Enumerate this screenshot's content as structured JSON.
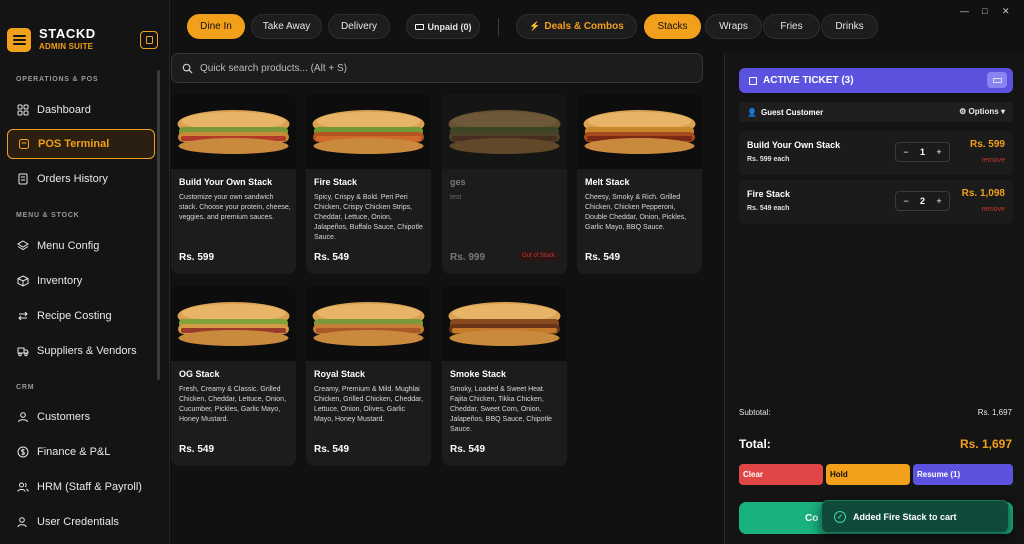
{
  "brand": {
    "name": "STACKD",
    "subtitle": "ADMIN SUITE"
  },
  "sidebar": {
    "sections": [
      "OPERATIONS & POS",
      "MENU & STOCK",
      "CRM"
    ],
    "items": [
      {
        "label": "Dashboard",
        "icon": "grid-icon"
      },
      {
        "label": "POS Terminal",
        "icon": "pos-icon"
      },
      {
        "label": "Orders History",
        "icon": "receipt-icon"
      },
      {
        "label": "Menu Config",
        "icon": "layers-icon"
      },
      {
        "label": "Inventory",
        "icon": "box-icon"
      },
      {
        "label": "Recipe Costing",
        "icon": "arrows-icon"
      },
      {
        "label": "Suppliers & Vendors",
        "icon": "truck-icon"
      },
      {
        "label": "Customers",
        "icon": "user-icon"
      },
      {
        "label": "Finance & P&L",
        "icon": "dollar-icon"
      },
      {
        "label": "HRM (Staff & Payroll)",
        "icon": "users-icon"
      },
      {
        "label": "User Credentials",
        "icon": "user-plus-icon"
      }
    ],
    "active": "POS Terminal"
  },
  "topbar": {
    "order_types": [
      "Dine In",
      "Take Away",
      "Delivery"
    ],
    "unpaid": "Unpaid (0)",
    "categories": [
      "Deals & Combos",
      "Stacks",
      "Wraps",
      "Fries",
      "Drinks"
    ],
    "active_category": "Stacks",
    "window_controls": [
      "—",
      "□",
      "✕"
    ]
  },
  "search": {
    "placeholder": "Quick search products... (Alt + S)"
  },
  "products": [
    {
      "name": "Build Your Own Stack",
      "desc": "Customize your own sandwich stack. Choose your protein, cheese, veggies, and premium sauces.",
      "price": "Rs. 599"
    },
    {
      "name": "Fire Stack",
      "desc": "Spicy, Crispy & Bold. Peri Peri Chicken, Crispy Chicken Strips, Cheddar, Lettuce, Onion, Jalapeños, Buffalo Sauce, Chipotle Sauce.",
      "price": "Rs. 549"
    },
    {
      "name": "ges",
      "desc": "test",
      "price": "Rs. 999",
      "status": "Out of Stock"
    },
    {
      "name": "Melt Stack",
      "desc": "Cheesy, Smoky & Rich. Grilled Chicken, Chicken Pepperoni, Double Cheddar, Onion, Pickles, Garlic Mayo, BBQ Sauce.",
      "price": "Rs. 549"
    },
    {
      "name": "OG Stack",
      "desc": "Fresh, Creamy & Classic. Grilled Chicken, Cheddar, Lettuce, Onion, Cucumber, Pickles, Garlic Mayo, Honey Mustard.",
      "price": "Rs. 549"
    },
    {
      "name": "Royal Stack",
      "desc": "Creamy, Premium & Mild. Mughlai Chicken, Grilled Chicken, Cheddar, Lettuce, Onion, Olives, Garlic Mayo, Honey Mustard.",
      "price": "Rs. 549"
    },
    {
      "name": "Smoke Stack",
      "desc": "Smoky, Loaded & Sweet Heat. Fajita Chicken, Tikka Chicken, Cheddar, Sweet Corn, Onion, Jalapeños, BBQ Sauce, Chipotle Sauce.",
      "price": "Rs. 549"
    }
  ],
  "ticket": {
    "title": "ACTIVE TICKET (3)",
    "customer": "Guest Customer",
    "options_label": "Options",
    "lines": [
      {
        "name": "Build Your Own Stack",
        "each": "Rs. 599 each",
        "qty": "1",
        "total": "Rs. 599",
        "remove": "remove"
      },
      {
        "name": "Fire Stack",
        "each": "Rs. 549 each",
        "qty": "2",
        "total": "Rs. 1,098",
        "remove": "remove"
      }
    ],
    "subtotal_label": "Subtotal:",
    "subtotal": "Rs. 1,697",
    "total_label": "Total:",
    "total": "Rs. 1,697",
    "clear_label": "Clear",
    "hold_label": "Hold",
    "resume_label": "Resume (1)",
    "checkout_label": "Co"
  },
  "toast": {
    "message": "Added Fire Stack to cart"
  },
  "colors": {
    "accent": "#f29f1c",
    "purple": "#5b53e0",
    "green": "#19b17e",
    "danger": "#e04646"
  }
}
